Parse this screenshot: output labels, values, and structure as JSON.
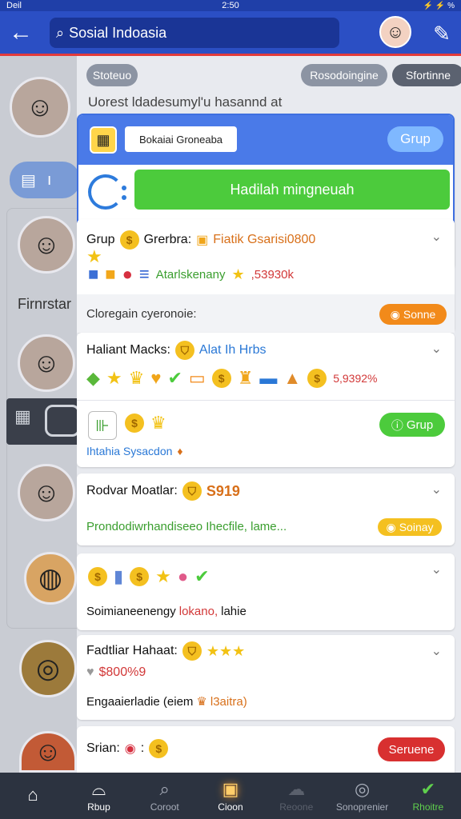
{
  "status_bar": {
    "carrier": "Deil",
    "time": "2:50",
    "right": "⚡ ⚡ %"
  },
  "app_bar": {
    "back_label": "←",
    "search_text": "Sosial Indoasia",
    "search_icon": "⌕",
    "tool_icon": "✎"
  },
  "left_column": {
    "label": "Firnrstar"
  },
  "main": {
    "chip_left": "Stoteuo",
    "chip_right1": "Rosodoingine",
    "chip_right2": "Sfortinne",
    "subtitle": "Uorest ldadesumyl'u hasannd at"
  },
  "group_card": {
    "title": "Bokaiai Groneaba",
    "grup_button": "Grup",
    "green_button": "Hadilah mingneuah"
  },
  "rows": [
    {
      "title": "Grup",
      "title2": "Grerbra:",
      "promo": "Fiatik Gsarisi0800",
      "side_text": "Atarlskenany",
      "side_value": ",53930k",
      "footer": "Cloregain cyeronoie:",
      "footer_button": "Sonne"
    },
    {
      "title": "Haliant Macks:",
      "link": "Alat Ih Hrbs",
      "percent": "5,9392%",
      "sub_button": "Grup",
      "sub_link": "Ihtahia Sysacdon"
    },
    {
      "title": "Rodvar Moatlar:",
      "value": "S919",
      "text": "Prondodiwrhandiseeo Ihecfile, lame...",
      "button": "Soinay"
    },
    {
      "text": "Soimianeenengy",
      "text_red": "lokano,",
      "text_end": "lahie"
    },
    {
      "title": "Fadtliar Hahaat:",
      "value": "$800%9",
      "text": "Engaaierladie (eiem",
      "text_orange": "l3aitra)"
    },
    {
      "title": "Srian:",
      "button": "Seruene"
    }
  ],
  "bottom_nav": [
    {
      "label": "",
      "icon": "home-icon"
    },
    {
      "label": "Rbup",
      "icon": "shop-icon"
    },
    {
      "label": "Coroot",
      "icon": "search-icon"
    },
    {
      "label": "Cioon",
      "icon": "bag-icon"
    },
    {
      "label": "Reoone",
      "icon": "cloud-icon"
    },
    {
      "label": "Sonoprenier",
      "icon": "compass-icon"
    },
    {
      "label": "Rhoitre",
      "icon": "check-icon"
    }
  ],
  "colors": {
    "appbar": "#2b4fc4",
    "accent_green": "#4ccb3c",
    "accent_orange": "#f28a1a",
    "accent_red": "#d83030"
  }
}
